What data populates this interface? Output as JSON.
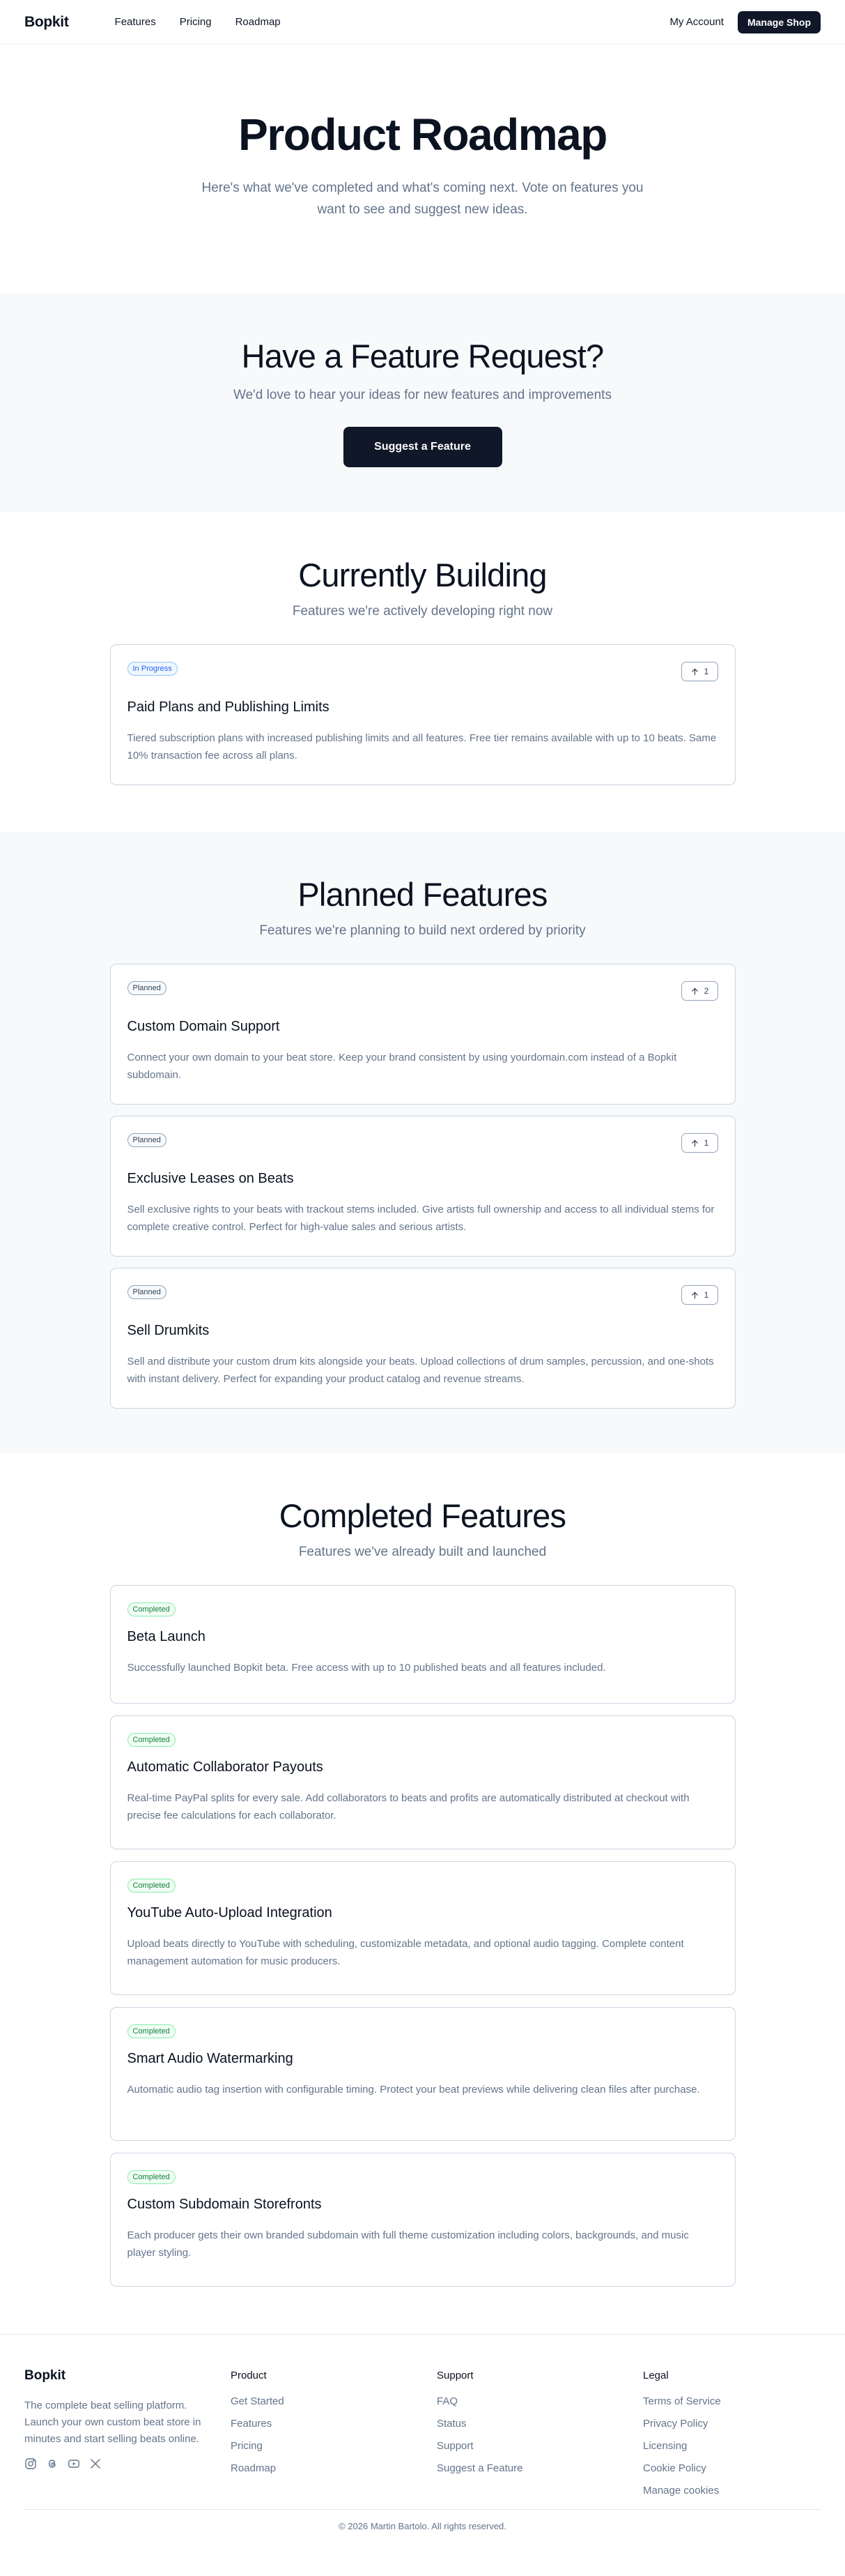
{
  "header": {
    "logo": "Bopkit",
    "nav": [
      "Features",
      "Pricing",
      "Roadmap"
    ],
    "account": "My Account",
    "manage": "Manage Shop"
  },
  "hero": {
    "title": "Product Roadmap",
    "subtitle": "Here's what we've completed and what's coming next. Vote on features you want to see and suggest new ideas."
  },
  "request": {
    "title": "Have a Feature Request?",
    "subtitle": "We'd love to hear your ideas for new features and improvements",
    "button": "Suggest a Feature"
  },
  "building": {
    "title": "Currently Building",
    "subtitle": "Features we're actively developing right now",
    "items": [
      {
        "badge": "In Progress",
        "votes": "1",
        "title": "Paid Plans and Publishing Limits",
        "desc": "Tiered subscription plans with increased publishing limits and all features. Free tier remains available with up to 10 beats. Same 10% transaction fee across all plans."
      }
    ]
  },
  "planned": {
    "title": "Planned Features",
    "subtitle": "Features we're planning to build next ordered by priority",
    "items": [
      {
        "badge": "Planned",
        "votes": "2",
        "title": "Custom Domain Support",
        "desc": "Connect your own domain to your beat store. Keep your brand consistent by using yourdomain.com instead of a Bopkit subdomain."
      },
      {
        "badge": "Planned",
        "votes": "1",
        "title": "Exclusive Leases on Beats",
        "desc": "Sell exclusive rights to your beats with trackout stems included. Give artists full ownership and access to all individual stems for complete creative control. Perfect for high-value sales and serious artists."
      },
      {
        "badge": "Planned",
        "votes": "1",
        "title": "Sell Drumkits",
        "desc": "Sell and distribute your custom drum kits alongside your beats. Upload collections of drum samples, percussion, and one-shots with instant delivery. Perfect for expanding your product catalog and revenue streams."
      }
    ]
  },
  "completed": {
    "title": "Completed Features",
    "subtitle": "Features we've already built and launched",
    "items": [
      {
        "badge": "Completed",
        "title": "Beta Launch",
        "desc": "Successfully launched Bopkit beta. Free access with up to 10 published beats and all features included."
      },
      {
        "badge": "Completed",
        "title": "Automatic Collaborator Payouts",
        "desc": "Real-time PayPal splits for every sale. Add collaborators to beats and profits are automatically distributed at checkout with precise fee calculations for each collaborator."
      },
      {
        "badge": "Completed",
        "title": "YouTube Auto-Upload Integration",
        "desc": "Upload beats directly to YouTube with scheduling, customizable metadata, and optional audio tagging. Complete content management automation for music producers."
      },
      {
        "badge": "Completed",
        "title": "Smart Audio Watermarking",
        "desc": "Automatic audio tag insertion with configurable timing. Protect your beat previews while delivering clean files after purchase."
      },
      {
        "badge": "Completed",
        "title": "Custom Subdomain Storefronts",
        "desc": "Each producer gets their own branded subdomain with full theme customization including colors, backgrounds, and music player styling."
      }
    ]
  },
  "footer": {
    "logo": "Bopkit",
    "desc": "The complete beat selling platform. Launch your own custom beat store in minutes and start selling beats online.",
    "socials": [
      "instagram-icon",
      "threads-icon",
      "youtube-icon",
      "x-icon"
    ],
    "product": {
      "title": "Product",
      "links": [
        "Get Started",
        "Features",
        "Pricing",
        "Roadmap"
      ]
    },
    "support": {
      "title": "Support",
      "links": [
        "FAQ",
        "Status",
        "Support",
        "Suggest a Feature"
      ]
    },
    "legal": {
      "title": "Legal",
      "links": [
        "Terms of Service",
        "Privacy Policy",
        "Licensing",
        "Cookie Policy",
        "Manage cookies"
      ]
    },
    "copyright": "© 2026 Martin Bartolo. All rights reserved."
  }
}
